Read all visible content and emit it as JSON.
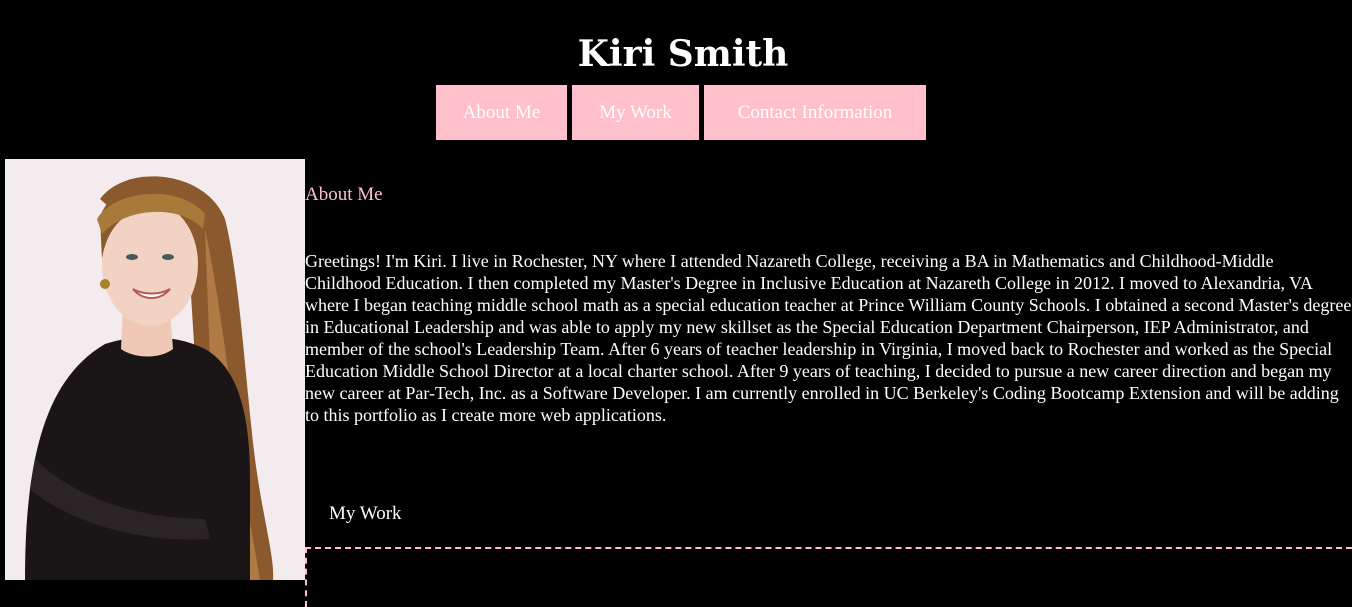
{
  "header": {
    "title": "Kiri Smith"
  },
  "nav": {
    "items": [
      {
        "label": "About Me"
      },
      {
        "label": "My Work"
      },
      {
        "label": "Contact Information"
      }
    ]
  },
  "about": {
    "heading": "About Me",
    "text": "Greetings! I'm Kiri. I live in Rochester, NY where I attended Nazareth College, receiving a BA in Mathematics and Childhood-Middle Childhood Education. I then completed my Master's Degree in Inclusive Education at Nazareth College in 2012. I moved to Alexandria, VA where I began teaching middle school math as a special education teacher at Prince William County Schools. I obtained a second Master's degree in Educational Leadership and was able to apply my new skillset as the Special Education Department Chairperson, IEP Administrator, and member of the school's Leadership Team. After 6 years of teacher leadership in Virginia, I moved back to Rochester and worked as the Special Education Middle School Director at a local charter school. After 9 years of teaching, I decided to pursue a new career direction and began my new career at Par-Tech, Inc. as a Software Developer. I am currently enrolled in UC Berkeley's Coding Bootcamp Extension and will be adding to this portfolio as I create more web applications."
  },
  "work": {
    "heading": "My Work"
  },
  "colors": {
    "background": "#000000",
    "accent": "#ffc0cb",
    "text": "#ffffff"
  }
}
